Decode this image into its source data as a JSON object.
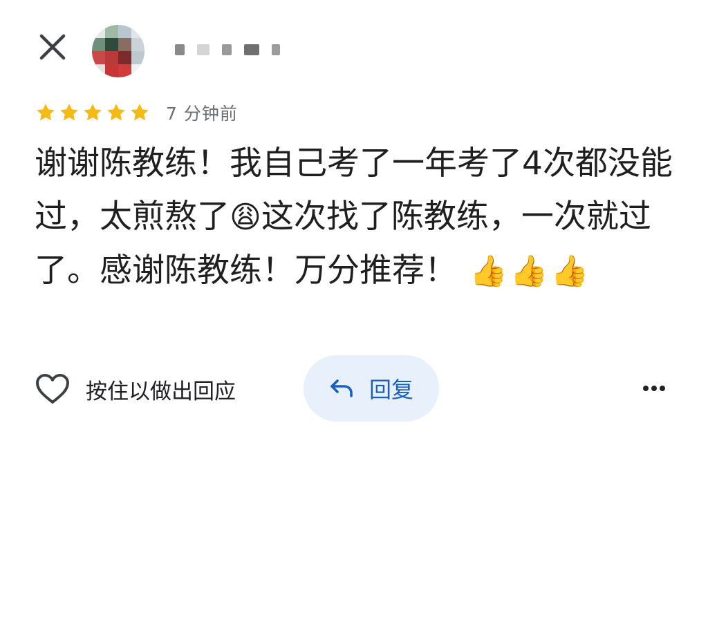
{
  "header": {
    "close_icon": "close-icon",
    "avatar_icon": "avatar-blurred",
    "name_redacted": true
  },
  "review": {
    "rating": 5,
    "rating_max": 5,
    "time_ago": "7 分钟前",
    "text_part1": "谢谢陈教练！我自己考了一年考了4次都没能过，太煎熬了",
    "emoji_weary": "😩",
    "text_part2": "这次找了陈教练，一次就过了。感谢陈教练！万分推荐！",
    "emoji_thumbs": "👍👍👍"
  },
  "actions": {
    "like_label": "按住以做出回应",
    "like_icon": "heart-outline-icon",
    "reply_label": "回复",
    "reply_icon": "reply-arrow-icon",
    "more_icon": "more-horizontal-icon"
  },
  "colors": {
    "star": "#F5BA14",
    "reply_bg": "#E8F0FB",
    "reply_text": "#1A5FC0",
    "text_primary": "#1F1F1F",
    "text_secondary": "#6B6E72"
  }
}
